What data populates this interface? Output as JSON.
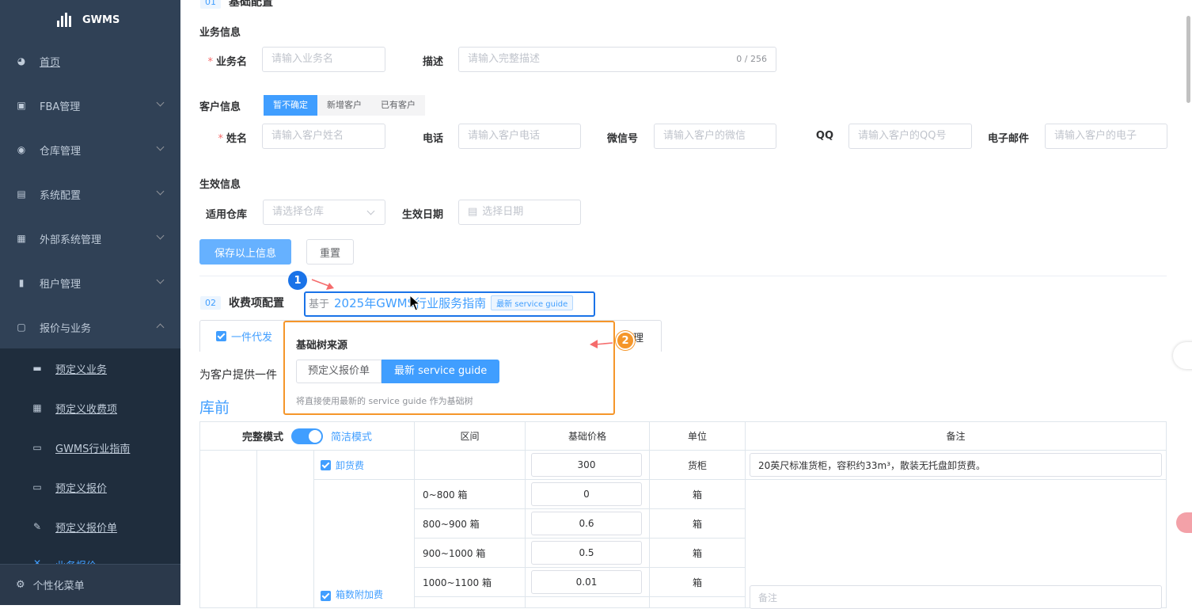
{
  "app": {
    "logo_text": "GWMS"
  },
  "sidebar": {
    "items": [
      {
        "label": "首页",
        "icon": "dashboard-icon"
      },
      {
        "label": "FBA管理",
        "icon": "box-icon"
      },
      {
        "label": "仓库管理",
        "icon": "globe-icon"
      },
      {
        "label": "系统配置",
        "icon": "list-icon"
      },
      {
        "label": "外部系统管理",
        "icon": "grid-icon"
      },
      {
        "label": "租户管理",
        "icon": "bar-chart-icon"
      },
      {
        "label": "报价与业务",
        "icon": "document-icon"
      }
    ],
    "sub_items": [
      {
        "label": "预定义业务",
        "icon": "clapper-icon"
      },
      {
        "label": "预定义收费项",
        "icon": "table-icon"
      },
      {
        "label": "GWMS行业指南",
        "icon": "doc-search-icon"
      },
      {
        "label": "预定义报价",
        "icon": "doc-search-icon"
      },
      {
        "label": "预定义报价单",
        "icon": "edit-icon"
      },
      {
        "label": "业务报价",
        "icon": "close-icon"
      }
    ],
    "custom_menu": "个性化菜单"
  },
  "section1": {
    "num": "01",
    "title": "基础配置",
    "business": {
      "heading": "业务信息",
      "name_label": "业务名",
      "name_placeholder": "请输入业务名",
      "desc_label": "描述",
      "desc_placeholder": "请输入完整描述",
      "desc_count": "0 / 256"
    },
    "customer": {
      "heading": "客户信息",
      "options": [
        "暂不确定",
        "新增客户",
        "已有客户"
      ],
      "selected": "暂不确定",
      "name_label": "姓名",
      "name_placeholder": "请输入客户姓名",
      "phone_label": "电话",
      "phone_placeholder": "请输入客户电话",
      "wechat_label": "微信号",
      "wechat_placeholder": "请输入客户的微信",
      "qq_label": "QQ",
      "qq_placeholder": "请输入客户的QQ号",
      "email_label": "电子邮件",
      "email_placeholder": "请输入客户的电子"
    },
    "effective": {
      "heading": "生效信息",
      "warehouse_label": "适用仓库",
      "warehouse_placeholder": "请选择仓库",
      "date_label": "生效日期",
      "date_placeholder": "选择日期"
    },
    "save_button": "保存以上信息",
    "reset_button": "重置"
  },
  "section2": {
    "num": "02",
    "title": "收费项配置",
    "based_on_prefix": "基于",
    "based_on_name": "2025年GWMS行业服务指南",
    "based_on_tag": "最新 service guide",
    "tab_active": "一件代发",
    "tab_partial": "理",
    "description_partial": "为客户提供一件",
    "subheading": "库前"
  },
  "popover": {
    "title": "基础树来源",
    "options": [
      "预定义报价单",
      "最新 service guide"
    ],
    "selected": "最新 service guide",
    "hint": "将直接使用最新的 service guide 作为基础树"
  },
  "annotations": {
    "marker1": "1",
    "marker2": "2"
  },
  "table": {
    "mode_full": "完整模式",
    "mode_simple": "简洁模式",
    "mode_simple_on": true,
    "headers": [
      "区间",
      "基础价格",
      "单位",
      "备注"
    ],
    "rows": [
      {
        "item": "卸货费",
        "range": "",
        "price": "300",
        "unit": "货柜",
        "note": "20英尺标准货柜，容积约33m³，散装无托盘卸货费。"
      },
      {
        "item": "箱数附加费",
        "range": "0~800 箱",
        "price": "0",
        "unit": "箱"
      },
      {
        "item": "",
        "range": "800~900 箱",
        "price": "0.6",
        "unit": "箱"
      },
      {
        "item": "",
        "range": "900~1000 箱",
        "price": "0.5",
        "unit": "箱"
      },
      {
        "item": "",
        "range": "1000~1100 箱",
        "price": "0.01",
        "unit": "箱"
      }
    ],
    "note_placeholder": "备注"
  },
  "colors": {
    "accent": "#409eff",
    "sidebar": "#304156",
    "highlight_blue": "#1a73e8",
    "highlight_orange": "#f5962a",
    "arrow_red": "#f56c6c"
  }
}
